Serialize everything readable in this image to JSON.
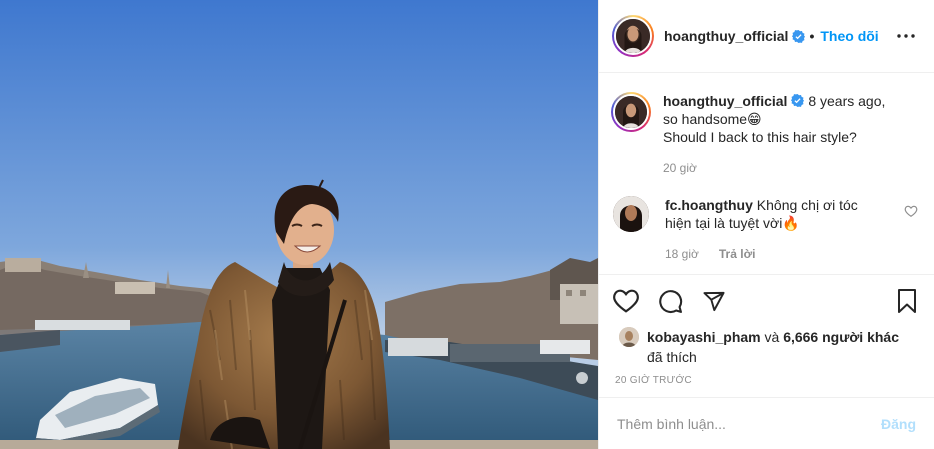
{
  "header": {
    "username": "hoangthuy_official",
    "separator": "•",
    "follow_label": "Theo dõi"
  },
  "icons": {
    "verified": "verified-badge-icon",
    "more": "more-options-icon",
    "like": "heart-icon",
    "comment": "comment-icon",
    "share": "paper-plane-icon",
    "save": "bookmark-icon"
  },
  "caption": {
    "username": "hoangthuy_official",
    "text": "8 years ago,\nso handsome😁\nShould I back to this hair style?",
    "time": "20 giờ"
  },
  "comments": [
    {
      "username": "fc.hoangthuy",
      "text": "Không chị ơi tóc\nhiện tại là tuyệt vời🔥",
      "time": "18 giờ",
      "reply_label": "Trả lời"
    }
  ],
  "likes": {
    "first_liker": "kobayashi_pham",
    "connector": "và",
    "others": "6,666 người khác",
    "suffix": "đã thích"
  },
  "timestamp": "20 giờ trước",
  "add_comment": {
    "placeholder": "Thêm bình luận...",
    "post_label": "Đăng"
  },
  "colors": {
    "link_blue": "#0095f6",
    "post_disabled": "#b2dffc",
    "secondary_text": "#8e8e8e",
    "verified_blue": "#3897f0"
  }
}
